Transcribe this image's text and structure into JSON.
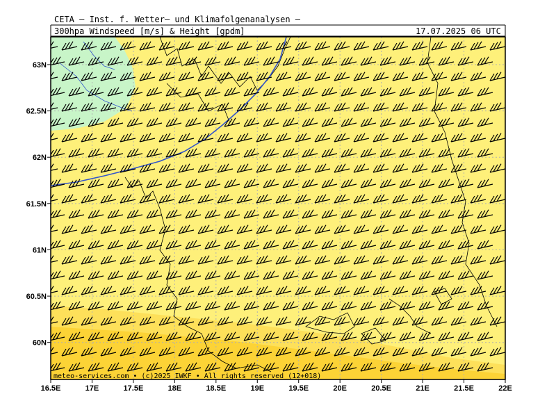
{
  "header": {
    "line1": "CETA — Inst. f. Wetter— und Klimafolgenanalysen —",
    "line2": "300hpa Windspeed [m/s] & Height [gpdm]",
    "valid_time": "17.07.2025 06 UTC"
  },
  "footer": {
    "credit": "meteo-services.com • (c)2025 IWKF • All rights reserved (12+018)"
  },
  "colors": {
    "speed_light": "#fef07a",
    "speed_mid": "#fde05a",
    "speed_high": "#fcd336",
    "speed_low": "#c8f5c8",
    "height_contour": "#3355cc",
    "coastline": "#000000",
    "grid": "#b0b0b0"
  },
  "map": {
    "projection": "lat-lon",
    "lon_range": [
      16.5,
      22.0
    ],
    "lat_range": [
      59.6,
      63.3
    ],
    "lon_ticks": [
      "16.5E",
      "17E",
      "17.5E",
      "18E",
      "18.5E",
      "19E",
      "19.5E",
      "20E",
      "20.5E",
      "21E",
      "21.5E",
      "22E"
    ],
    "lat_ticks": [
      "63N",
      "62.5N",
      "62N",
      "61.5N",
      "61N",
      "60.5N",
      "60N"
    ],
    "wind_direction": "westerly (WSW) at all grid points",
    "legend": "none shown"
  }
}
